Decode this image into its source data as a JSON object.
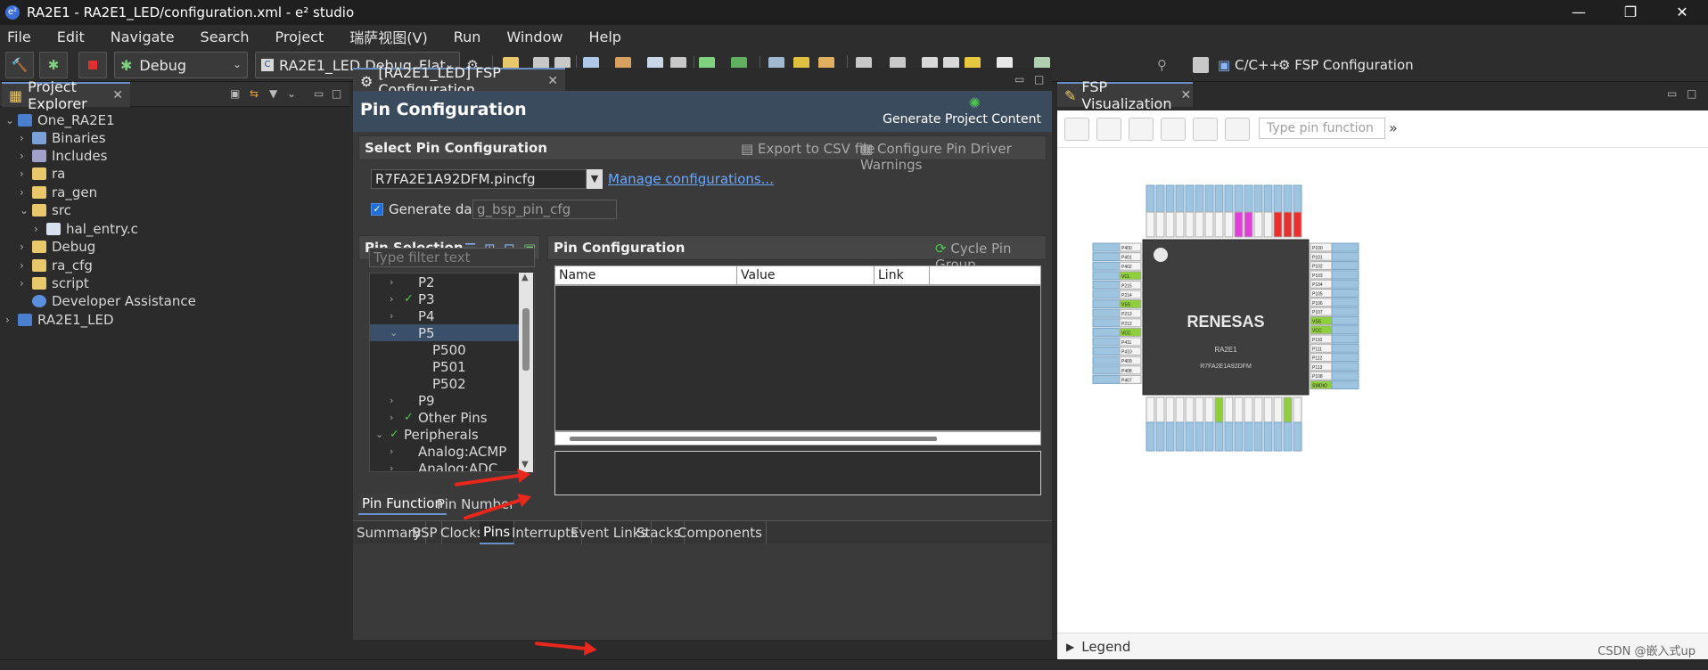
{
  "window": {
    "title": "RA2E1 - RA2E1_LED/configuration.xml - e² studio",
    "controls": [
      "—",
      "❐",
      "✕"
    ]
  },
  "menu": [
    "File",
    "Edit",
    "Navigate",
    "Search",
    "Project",
    "瑞萨视图(V)",
    "Run",
    "Window",
    "Help"
  ],
  "toolbar": {
    "build_config": "Debug",
    "launch_config": "RA2E1_LED Debug_Flat",
    "perspective_cpp": "C/C++",
    "perspective_fsp": "FSP Configuration"
  },
  "project_explorer": {
    "tab_label": "Project Explorer",
    "items": [
      {
        "label": "One_RA2E1",
        "arrow": "⌄",
        "icon": "project-icon"
      },
      {
        "label": "Binaries",
        "arrow": "›",
        "icon": "binaries-icon"
      },
      {
        "label": "Includes",
        "arrow": "›",
        "icon": "includes-icon"
      },
      {
        "label": "ra",
        "arrow": "›",
        "icon": "folder-icon"
      },
      {
        "label": "ra_gen",
        "arrow": "›",
        "icon": "folder-icon"
      },
      {
        "label": "src",
        "arrow": "⌄",
        "icon": "folder-icon"
      },
      {
        "label": "hal_entry.c",
        "arrow": "›",
        "icon": "c-file-icon"
      },
      {
        "label": "Debug",
        "arrow": "›",
        "icon": "folder-icon"
      },
      {
        "label": "ra_cfg",
        "arrow": "›",
        "icon": "folder-icon"
      },
      {
        "label": "script",
        "arrow": "›",
        "icon": "folder-icon"
      },
      {
        "label": "Developer Assistance",
        "arrow": "",
        "icon": "help-icon"
      },
      {
        "label": "RA2E1_LED",
        "arrow": "›",
        "icon": "project-icon"
      }
    ]
  },
  "editor": {
    "tab_label": "[RA2E1_LED] FSP Configuration",
    "page_title": "Pin Configuration",
    "generate_label": "Generate Project Content",
    "select_section": {
      "title": "Select Pin Configuration",
      "export_label": "Export to CSV file",
      "warnings_label": "Configure Pin Driver Warnings",
      "config_file": "R7FA2E1A92DFM.pincfg",
      "manage_link": "Manage configurations...",
      "generate_data_label": "Generate data:",
      "generate_data_value": "g_bsp_pin_cfg"
    },
    "pin_selection": {
      "title": "Pin Selection",
      "filter_placeholder": "Type filter text",
      "rows": [
        {
          "label": "P2",
          "chev": "›",
          "check": false,
          "level": 1,
          "selected": false
        },
        {
          "label": "P3",
          "chev": "›",
          "check": true,
          "level": 1,
          "selected": false
        },
        {
          "label": "P4",
          "chev": "›",
          "check": false,
          "level": 1,
          "selected": false
        },
        {
          "label": "P5",
          "chev": "⌄",
          "check": false,
          "level": 1,
          "selected": true
        },
        {
          "label": "P500",
          "chev": "",
          "check": false,
          "level": 2,
          "selected": false
        },
        {
          "label": "P501",
          "chev": "",
          "check": false,
          "level": 2,
          "selected": false
        },
        {
          "label": "P502",
          "chev": "",
          "check": false,
          "level": 2,
          "selected": false
        },
        {
          "label": "P9",
          "chev": "›",
          "check": false,
          "level": 1,
          "selected": false
        },
        {
          "label": "Other Pins",
          "chev": "›",
          "check": true,
          "level": 1,
          "selected": false
        },
        {
          "label": "Peripherals",
          "chev": "⌄",
          "check": true,
          "level": 0,
          "selected": false
        },
        {
          "label": "Analog:ACMP",
          "chev": "›",
          "check": false,
          "level": 1,
          "selected": false
        },
        {
          "label": "Analog:ADC",
          "chev": "›",
          "check": false,
          "level": 1,
          "selected": false
        }
      ]
    },
    "pin_config": {
      "title": "Pin Configuration",
      "cycle_label": "Cycle Pin Group",
      "columns": [
        "Name",
        "Value",
        "Link"
      ]
    },
    "sub_tabs": [
      "Pin Function",
      "Pin Number"
    ],
    "bottom_tabs": [
      "Summary",
      "BSP",
      "Clocks",
      "Pins",
      "Interrupts",
      "Event Links",
      "Stacks",
      "Components"
    ],
    "active_bottom_tab": "Pins"
  },
  "visualization": {
    "tab_label": "FSP Visualization",
    "search_placeholder": "Type pin function",
    "chip_brand": "RENESAS",
    "chip_family": "RA2E1",
    "chip_part": "R7FA2E1A92DFM",
    "legend_label": "Legend",
    "left_pins": [
      "P400",
      "P401",
      "P402",
      "VCL",
      "P215",
      "P214",
      "VSS",
      "P213",
      "P212",
      "VCC",
      "P411",
      "P410",
      "P409",
      "P408",
      "P407"
    ],
    "right_pins": [
      "P100",
      "P101",
      "P102",
      "P103",
      "P104",
      "P105",
      "P106",
      "P107",
      "VSS",
      "VCC",
      "P110",
      "P111",
      "P112",
      "P113",
      "P108",
      "SWDIO"
    ],
    "top_pin_count": 16,
    "bottom_pin_count": 16
  },
  "watermark": "CSDN @嵌入式up",
  "colors": {
    "accent": "#6b8fc7",
    "check_green": "#4fc44f",
    "link_blue": "#6aa8ff",
    "pin_blue": "#9fc4e0",
    "pin_green": "#8fce3c",
    "pin_magenta": "#e040d8",
    "pin_red": "#e83030",
    "annotation_red": "#e8271d"
  }
}
